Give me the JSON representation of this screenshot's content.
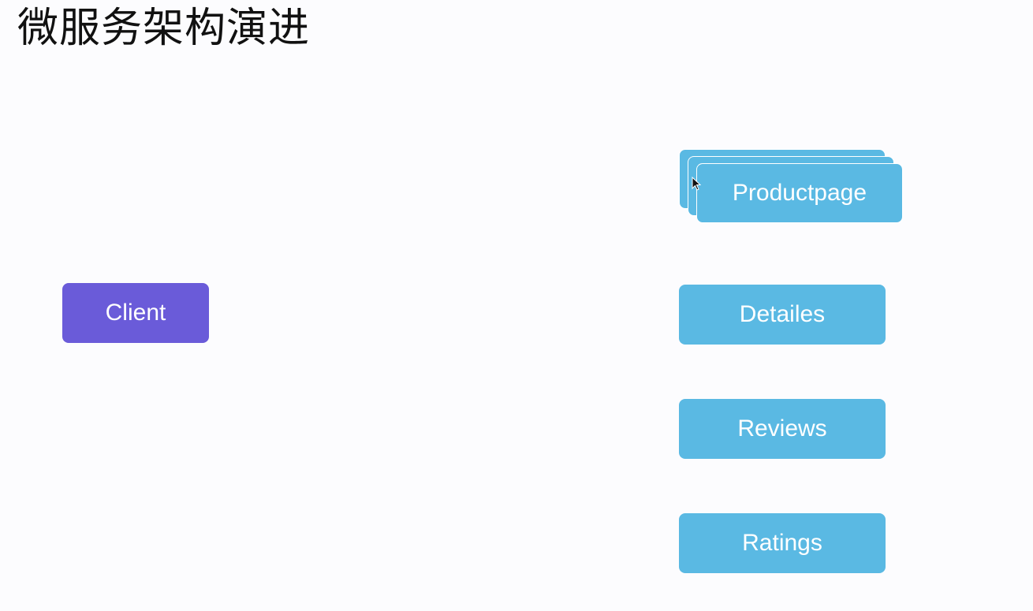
{
  "title": "微服务架构演进",
  "client": {
    "label": "Client",
    "color": "#6a5bd9"
  },
  "services": {
    "color": "#5ab9e3",
    "productpage": "Productpage",
    "details": "Detailes",
    "reviews": "Reviews",
    "ratings": "Ratings"
  },
  "cursor_icon": "mouse-pointer-icon"
}
